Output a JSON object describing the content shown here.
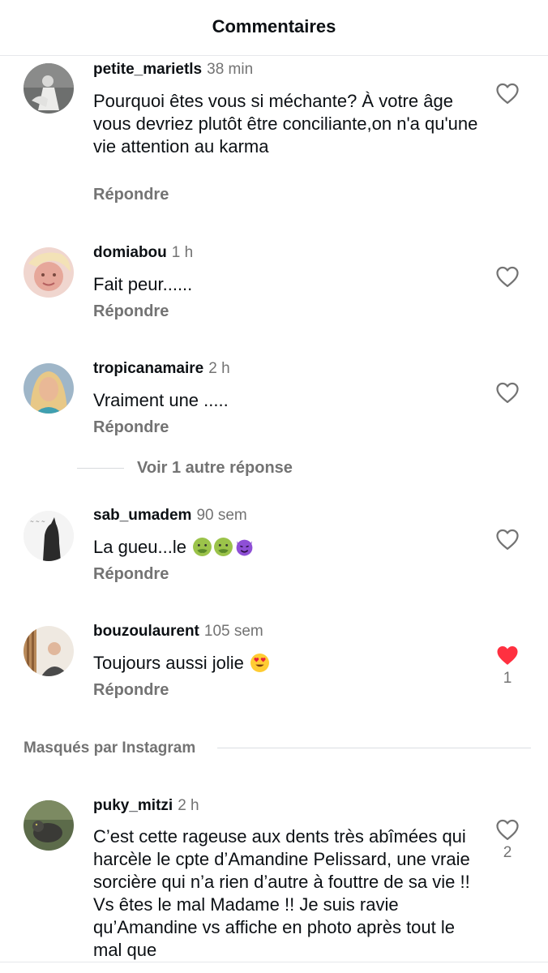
{
  "header": {
    "title": "Commentaires"
  },
  "comments": [
    {
      "username": "petite_marietls",
      "time": "38 min",
      "text": "Pourquoi êtes vous si méchante? À votre âge vous devriez plutôt être conciliante,on n'a qu'une vie attention au karma",
      "reply_label": "Répondre",
      "liked": false,
      "like_count": ""
    },
    {
      "username": "domiabou",
      "time": "1 h",
      "text": "Fait peur......",
      "reply_label": "Répondre",
      "liked": false,
      "like_count": ""
    },
    {
      "username": "tropicanamaire",
      "time": "2 h",
      "text": "Vraiment une .....",
      "reply_label": "Répondre",
      "liked": false,
      "like_count": ""
    },
    {
      "username": "sab_umadem",
      "time": "90 sem",
      "text": "La gueu...le",
      "emojis": [
        "nauseated-face",
        "nauseated-face",
        "smiling-face-with-horns"
      ],
      "reply_label": "Répondre",
      "liked": false,
      "like_count": ""
    },
    {
      "username": "bouzoulaurent",
      "time": "105 sem",
      "text": "Toujours aussi jolie",
      "emojis": [
        "heart-eyes-face"
      ],
      "reply_label": "Répondre",
      "liked": true,
      "like_count": "1"
    },
    {
      "username": "puky_mitzi",
      "time": "2 h",
      "text": "C’est cette rageuse aux dents très abîmées qui harcèle le cpte d’Amandine Pelissard, une vraie sorcière qui n’a rien d’autre à fouttre de sa vie !! Vs êtes le mal Madame !! Je suis ravie qu’Amandine vs affiche en photo après tout le mal que",
      "reply_label": "",
      "liked": false,
      "like_count": "2"
    }
  ],
  "more_replies": {
    "label": "Voir 1 autre réponse"
  },
  "hidden_section": {
    "label": "Masqués par Instagram"
  },
  "colors": {
    "like_active": "#ff3040",
    "muted_text": "#737373"
  }
}
